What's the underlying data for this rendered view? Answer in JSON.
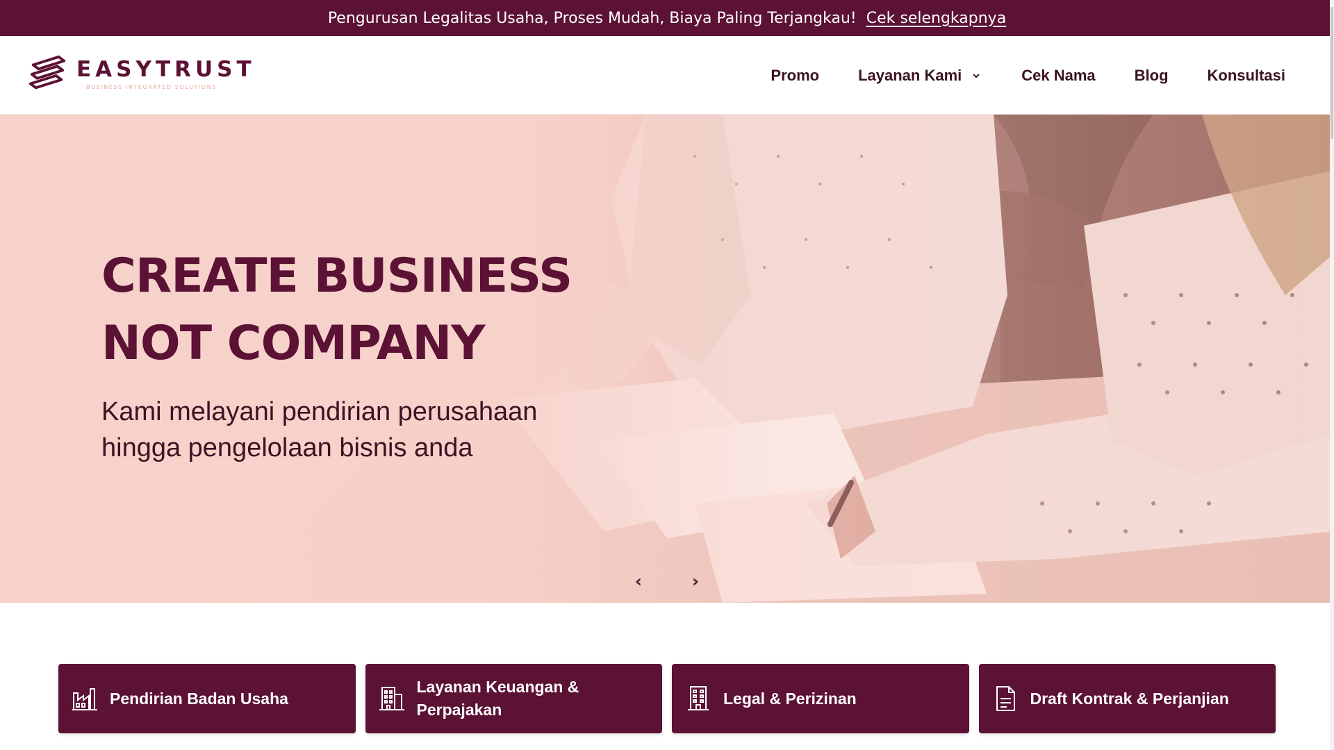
{
  "announcement": {
    "text": "Pengurusan Legalitas Usaha, Proses Mudah, Biaya Paling Terjangkau!",
    "link": "Cek selengkapnya"
  },
  "brand": {
    "name": "EASYTRUST",
    "tagline": "BUSINESS INTEGRATED SOLUTIONS"
  },
  "nav": {
    "items": [
      {
        "label": "Promo"
      },
      {
        "label": "Layanan Kami",
        "has_dropdown": true
      },
      {
        "label": "Cek Nama"
      },
      {
        "label": "Blog"
      },
      {
        "label": "Konsultasi"
      }
    ]
  },
  "hero": {
    "title_line1": "CREATE BUSINESS",
    "title_line2": "NOT COMPANY",
    "subtitle": "Kami melayani pendirian perusahaan hingga pengelolaan bisnis anda",
    "prev": "‹",
    "next": "›"
  },
  "services": [
    {
      "label": "Pendirian Badan Usaha",
      "icon": "factory-icon"
    },
    {
      "label": "Layanan Keuangan & Perpajakan",
      "icon": "building-icon"
    },
    {
      "label": "Legal & Perizinan",
      "icon": "office-building-icon"
    },
    {
      "label": "Draft Kontrak & Perjanjian",
      "icon": "document-icon"
    }
  ],
  "colors": {
    "brand": "#5c1234",
    "hero_bg": "#f7d2cb",
    "tagline": "#e7a8a0"
  }
}
